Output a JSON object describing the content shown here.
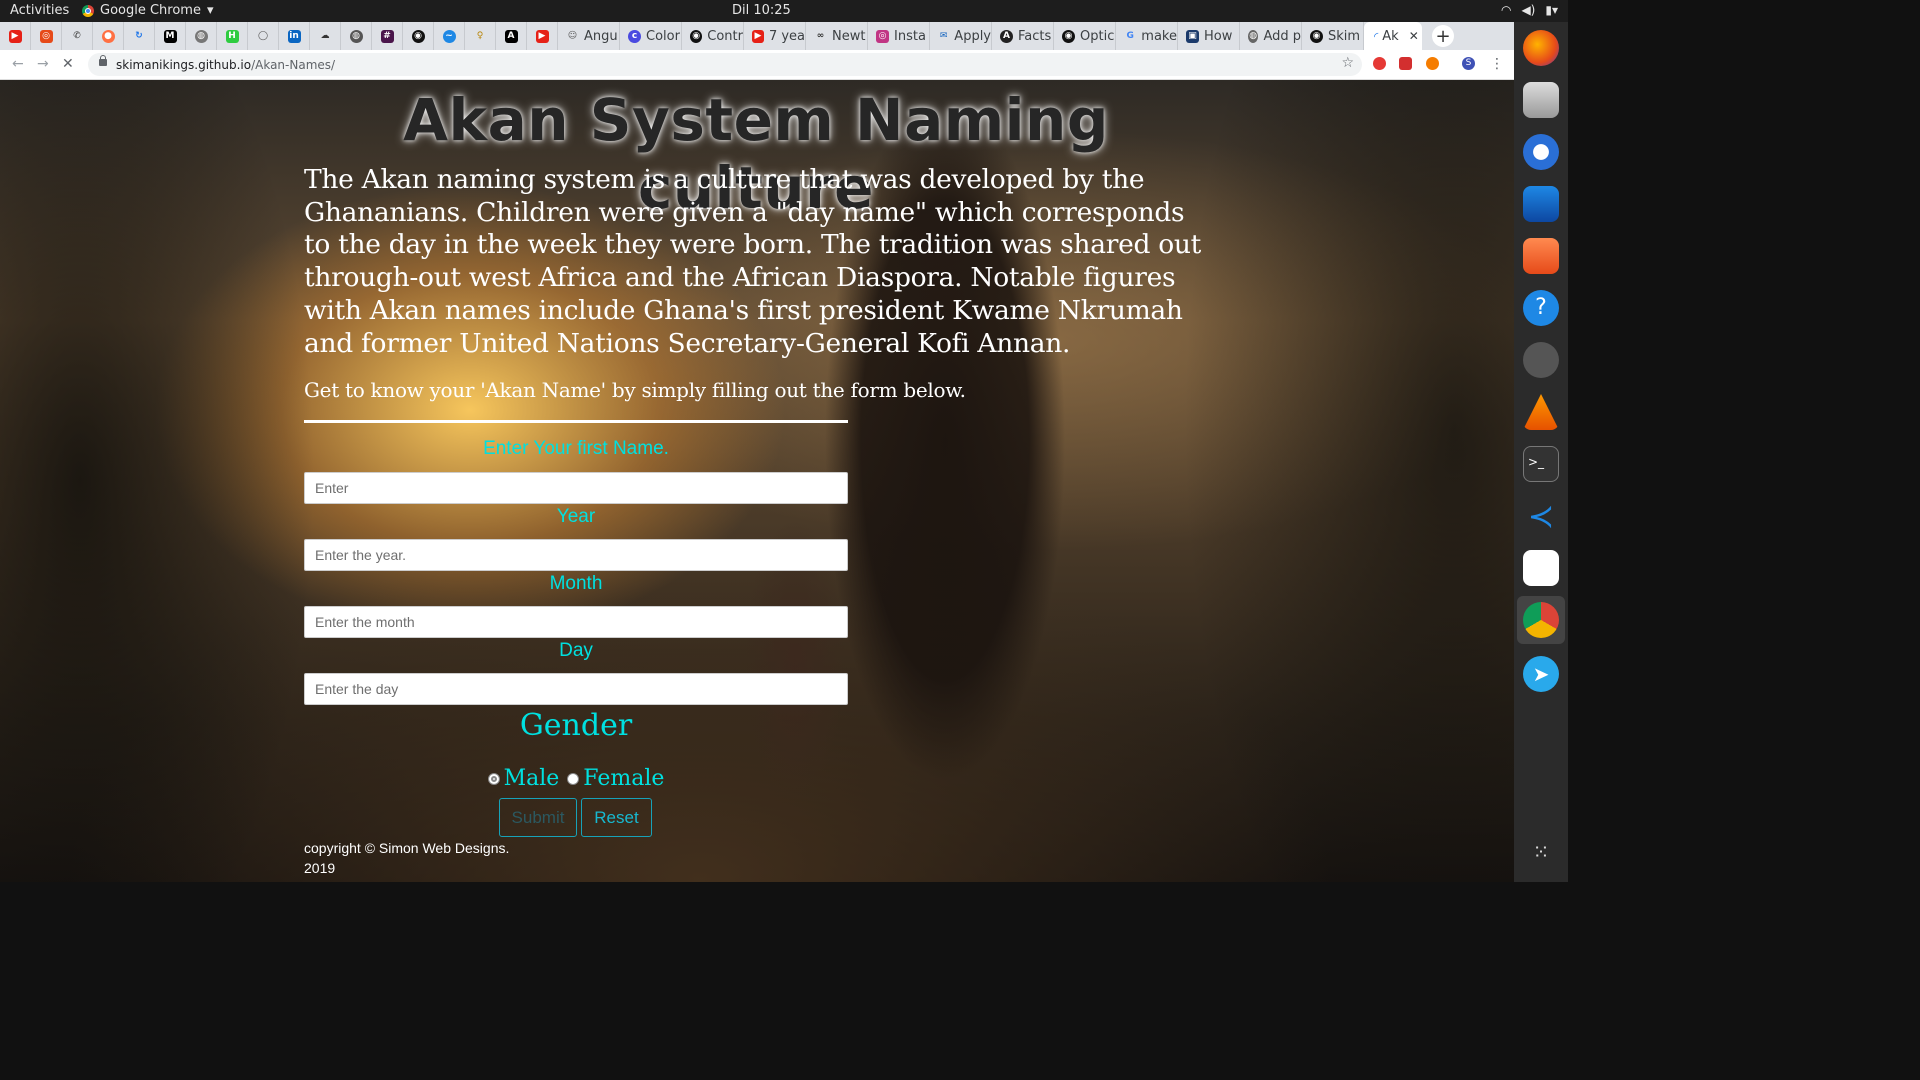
{
  "system_bar": {
    "activities": "Activities",
    "app_name": "Google Chrome",
    "clock": "Dil 10:25"
  },
  "browser": {
    "tabs_truncated": [
      "Angu",
      "Color",
      "Contr",
      "7 yea",
      "Newt",
      "Insta",
      "Apply",
      "Facts",
      "Optic",
      "make",
      "How",
      "Add p",
      "Skim"
    ],
    "active_tab": "Ak",
    "url_host": "skimanikings.github.io",
    "url_path": "/Akan-Names/"
  },
  "page": {
    "title": "Akan System Naming culture",
    "intro": "The Akan naming system is a culture that was developed by the Ghananians. Children were given a \"day name\" which corresponds to the day in the week they were born. The tradition was shared out through-out west Africa and the African Diaspora. Notable figures with Akan names include Ghana's first president Kwame Nkrumah and former United Nations Secretary-General Kofi Annan.",
    "cta": "Get to know your 'Akan Name' by simply filling out the form below.",
    "form": {
      "name_label": "Enter Your first Name.",
      "name_placeholder": "Enter",
      "year_label": "Year",
      "year_placeholder": "Enter the year.",
      "month_label": "Month",
      "month_placeholder": "Enter the month",
      "day_label": "Day",
      "day_placeholder": "Enter the day",
      "gender_label": "Gender",
      "male_label": "Male",
      "female_label": "Female",
      "submit_label": "Submit",
      "reset_label": "Reset"
    },
    "footer_line1": "copyright © Simon Web Designs.",
    "footer_line2": "2019"
  }
}
